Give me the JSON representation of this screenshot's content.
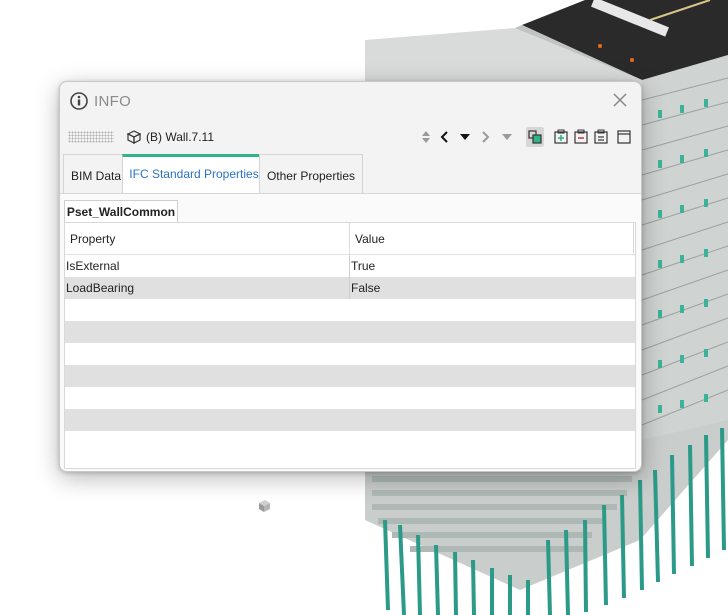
{
  "dialog": {
    "title": "INFO",
    "element_name": "(B) Wall.7.11"
  },
  "tabs": [
    {
      "label": "BIM Data",
      "active": false
    },
    {
      "label": "IFC Standard Properties",
      "active": true
    },
    {
      "label": "Other Properties",
      "active": false
    }
  ],
  "property_set": {
    "name": "Pset_WallCommon",
    "columns": [
      "Property",
      "Value"
    ],
    "rows": [
      {
        "property": "IsExternal",
        "value": "True"
      },
      {
        "property": "LoadBearing",
        "value": "False"
      }
    ]
  },
  "icons": {
    "title": "info-circle-icon",
    "close": "close-icon",
    "element": "box-element-icon",
    "toolbar": [
      "sort-up-down-icon",
      "prev-icon",
      "dropdown-icon",
      "next-icon",
      "dropdown-disabled-icon",
      "isolate-icon",
      "add-item-icon",
      "remove-item-icon",
      "delete-item-icon",
      "window-icon"
    ]
  },
  "colors": {
    "accent_tab": "#2fb38a",
    "active_tab_text": "#2a73c4",
    "piles": "#2b9a88"
  }
}
